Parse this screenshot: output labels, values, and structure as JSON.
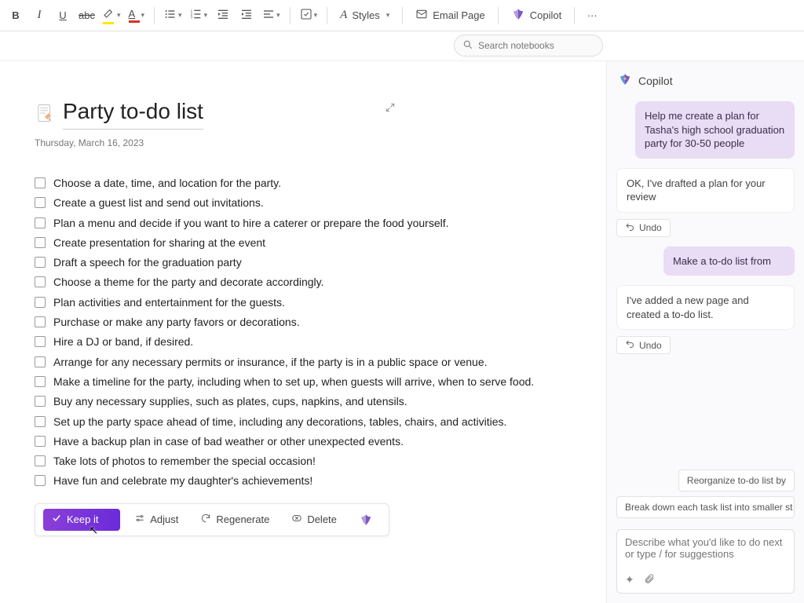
{
  "toolbar": {
    "bold": "B",
    "italic": "I",
    "underline": "U",
    "strike": "abc",
    "styles_label": "Styles",
    "email_label": "Email Page",
    "copilot_label": "Copilot",
    "more": "···"
  },
  "search": {
    "placeholder": "Search notebooks"
  },
  "page": {
    "title": "Party to-do list",
    "date": "Thursday, March 16, 2023",
    "todos": [
      "Choose a date, time, and location for the party.",
      "Create a guest list and send out invitations.",
      "Plan a menu and decide if you want to hire a caterer or prepare the food yourself.",
      "Create presentation for sharing at the event",
      "Draft a speech for the graduation party",
      "Choose a theme for the party and decorate accordingly.",
      "Plan activities and entertainment for the guests.",
      "Purchase or make any party favors or decorations.",
      "Hire a DJ or band, if desired.",
      "Arrange for any necessary permits or insurance, if the party is in a public space or venue.",
      "Make a timeline for the party, including when to set up, when guests will arrive, when to serve food.",
      "Buy any necessary supplies, such as plates, cups, napkins, and utensils.",
      "Set up the party space ahead of time, including any decorations, tables, chairs, and activities.",
      "Have a backup plan in case of bad weather or other unexpected events.",
      "Take lots of photos to remember the special occasion!",
      "Have fun and celebrate my daughter's achievements!"
    ],
    "inline": {
      "keep": "Keep it",
      "adjust": "Adjust",
      "regenerate": "Regenerate",
      "delete": "Delete"
    }
  },
  "copilot": {
    "title": "Copilot",
    "messages": {
      "u1": "Help me create a plan for Tasha's high school graduation party for 30-50 people",
      "b1": "OK, I've drafted a plan for your review",
      "u2": "Make a to-do list from",
      "b2": "I've added a new page and created a to-do list."
    },
    "undo": "Undo",
    "suggestions": {
      "s1": "Reorganize to-do list by",
      "s2": "Break down each task list into smaller st"
    },
    "composer_placeholder": "Describe what you'd like to do next or type / for suggestions"
  }
}
